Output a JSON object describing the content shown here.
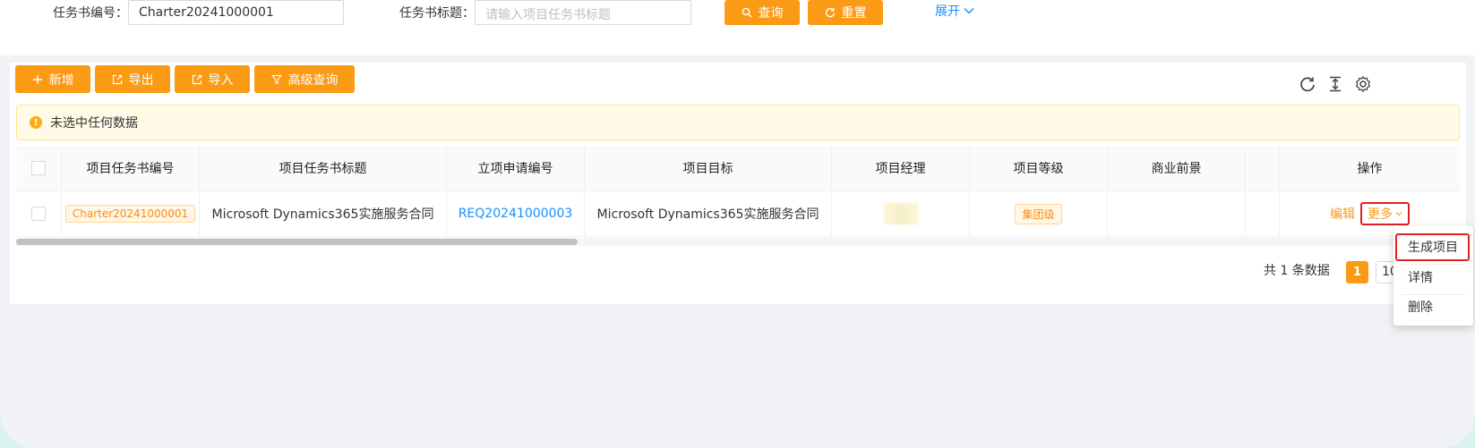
{
  "search": {
    "field1_label": "任务书编号：",
    "field1_value": "Charter20241000001",
    "field2_label": "任务书标题：",
    "field2_placeholder": "请输入项目任务书标题",
    "query_btn": "查询",
    "reset_btn": "重置",
    "expand_link": "展开"
  },
  "toolbar": {
    "add": "新增",
    "export": "导出",
    "import": "导入",
    "advanced": "高级查询"
  },
  "alert": {
    "text": "未选中任何数据"
  },
  "table": {
    "columns": [
      "项目任务书编号",
      "项目任务书标题",
      "立项申请编号",
      "项目目标",
      "项目经理",
      "项目等级",
      "商业前景",
      "",
      "操作"
    ],
    "rows": [
      {
        "charter_no": "Charter20241000001",
        "title": "Microsoft Dynamics365实施服务合同",
        "request_no": "REQ20241000003",
        "goal": "Microsoft Dynamics365实施服务合同",
        "manager": "",
        "level": "集团级",
        "prospect": "",
        "edit": "编辑",
        "more": "更多"
      }
    ]
  },
  "pagination": {
    "total_text": "共 1 条数据",
    "current_page": "1",
    "page_size": "10"
  },
  "dropdown": {
    "items": [
      "生成项目",
      "详情",
      "删除"
    ]
  },
  "colors": {
    "accent": "#fb9a14",
    "link": "#1890ff",
    "highlight": "#e02020"
  }
}
